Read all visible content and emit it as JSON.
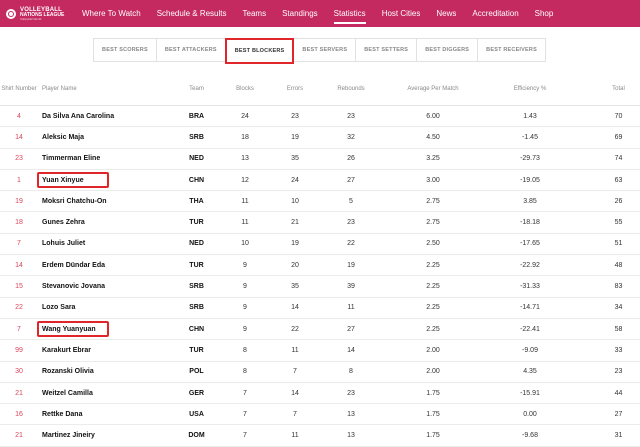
{
  "brand": {
    "line1": "VOLLEYBALL",
    "line2": "NATIONS LEAGUE",
    "line3": "Volleyball World"
  },
  "nav": {
    "items": [
      "Where To Watch",
      "Schedule & Results",
      "Teams",
      "Standings",
      "Statistics",
      "Host Cities",
      "News",
      "Accreditation",
      "Shop"
    ],
    "active_index": 4
  },
  "tabs": {
    "items": [
      "BEST SCORERS",
      "BEST ATTACKERS",
      "BEST BLOCKERS",
      "BEST SERVERS",
      "BEST SETTERS",
      "BEST DIGGERS",
      "BEST RECEIVERS"
    ],
    "active_index": 2
  },
  "table": {
    "headers": {
      "short": "Shirt Number",
      "name": "Player Name",
      "team": "Team",
      "blocks": "Blocks",
      "errors": "Errors",
      "rebounds": "Rebounds",
      "avg": "Average Per Match",
      "eff": "Efficiency %",
      "total": "Total"
    },
    "rows": [
      {
        "short": "4",
        "name": "Da Silva Ana Carolina",
        "team": "BRA",
        "blocks": "24",
        "errors": "23",
        "rebounds": "23",
        "avg": "6.00",
        "eff": "1.43",
        "total": "70"
      },
      {
        "short": "14",
        "name": "Aleksic Maja",
        "team": "SRB",
        "blocks": "18",
        "errors": "19",
        "rebounds": "32",
        "avg": "4.50",
        "eff": "-1.45",
        "total": "69"
      },
      {
        "short": "23",
        "name": "Timmerman Eline",
        "team": "NED",
        "blocks": "13",
        "errors": "35",
        "rebounds": "26",
        "avg": "3.25",
        "eff": "-29.73",
        "total": "74"
      },
      {
        "short": "1",
        "name": "Yuan Xinyue",
        "team": "CHN",
        "blocks": "12",
        "errors": "24",
        "rebounds": "27",
        "avg": "3.00",
        "eff": "-19.05",
        "total": "63",
        "highlight": true
      },
      {
        "short": "19",
        "name": "Moksri Chatchu-On",
        "team": "THA",
        "blocks": "11",
        "errors": "10",
        "rebounds": "5",
        "avg": "2.75",
        "eff": "3.85",
        "total": "26"
      },
      {
        "short": "18",
        "name": "Gunes Zehra",
        "team": "TUR",
        "blocks": "11",
        "errors": "21",
        "rebounds": "23",
        "avg": "2.75",
        "eff": "-18.18",
        "total": "55"
      },
      {
        "short": "7",
        "name": "Lohuis Juliet",
        "team": "NED",
        "blocks": "10",
        "errors": "19",
        "rebounds": "22",
        "avg": "2.50",
        "eff": "-17.65",
        "total": "51"
      },
      {
        "short": "14",
        "name": "Erdem Dündar Eda",
        "team": "TUR",
        "blocks": "9",
        "errors": "20",
        "rebounds": "19",
        "avg": "2.25",
        "eff": "-22.92",
        "total": "48"
      },
      {
        "short": "15",
        "name": "Stevanovic Jovana",
        "team": "SRB",
        "blocks": "9",
        "errors": "35",
        "rebounds": "39",
        "avg": "2.25",
        "eff": "-31.33",
        "total": "83"
      },
      {
        "short": "22",
        "name": "Lozo Sara",
        "team": "SRB",
        "blocks": "9",
        "errors": "14",
        "rebounds": "11",
        "avg": "2.25",
        "eff": "-14.71",
        "total": "34"
      },
      {
        "short": "7",
        "name": "Wang Yuanyuan",
        "team": "CHN",
        "blocks": "9",
        "errors": "22",
        "rebounds": "27",
        "avg": "2.25",
        "eff": "-22.41",
        "total": "58",
        "highlight": true
      },
      {
        "short": "99",
        "name": "Karakurt Ebrar",
        "team": "TUR",
        "blocks": "8",
        "errors": "11",
        "rebounds": "14",
        "avg": "2.00",
        "eff": "-9.09",
        "total": "33"
      },
      {
        "short": "30",
        "name": "Rozanski Olivia",
        "team": "POL",
        "blocks": "8",
        "errors": "7",
        "rebounds": "8",
        "avg": "2.00",
        "eff": "4.35",
        "total": "23"
      },
      {
        "short": "21",
        "name": "Weitzel Camilla",
        "team": "GER",
        "blocks": "7",
        "errors": "14",
        "rebounds": "23",
        "avg": "1.75",
        "eff": "-15.91",
        "total": "44"
      },
      {
        "short": "16",
        "name": "Rettke Dana",
        "team": "USA",
        "blocks": "7",
        "errors": "7",
        "rebounds": "13",
        "avg": "1.75",
        "eff": "0.00",
        "total": "27"
      },
      {
        "short": "21",
        "name": "Martinez Jineiry",
        "team": "DOM",
        "blocks": "7",
        "errors": "11",
        "rebounds": "13",
        "avg": "1.75",
        "eff": "-9.68",
        "total": "31"
      }
    ]
  },
  "colors": {
    "nav_bg": "#c4295f",
    "highlight": "#e0262b",
    "shirt_number": "#d8455c"
  }
}
